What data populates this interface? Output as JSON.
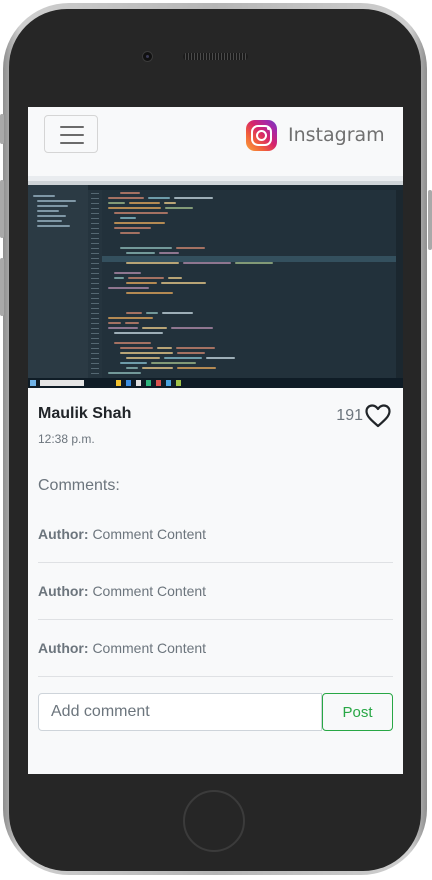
{
  "navbar": {
    "brand_text": "Instagram",
    "brand_icon": "instagram-logo-icon",
    "toggler_icon": "hamburger-menu-icon"
  },
  "post": {
    "author": "Maulik Shah",
    "time": "12:38 p.m.",
    "likes": "191",
    "like_icon": "heart-outline-icon"
  },
  "comments": {
    "heading": "Comments:",
    "items": [
      {
        "author": "Author:",
        "content": "Comment Content"
      },
      {
        "author": "Author:",
        "content": "Comment Content"
      },
      {
        "author": "Author:",
        "content": "Comment Content"
      }
    ]
  },
  "comment_form": {
    "placeholder": "Add comment",
    "submit_label": "Post"
  },
  "colors": {
    "background": "#f8f9fa",
    "text_muted": "#6c757d",
    "success": "#28a745",
    "phone_body": "#262626"
  }
}
